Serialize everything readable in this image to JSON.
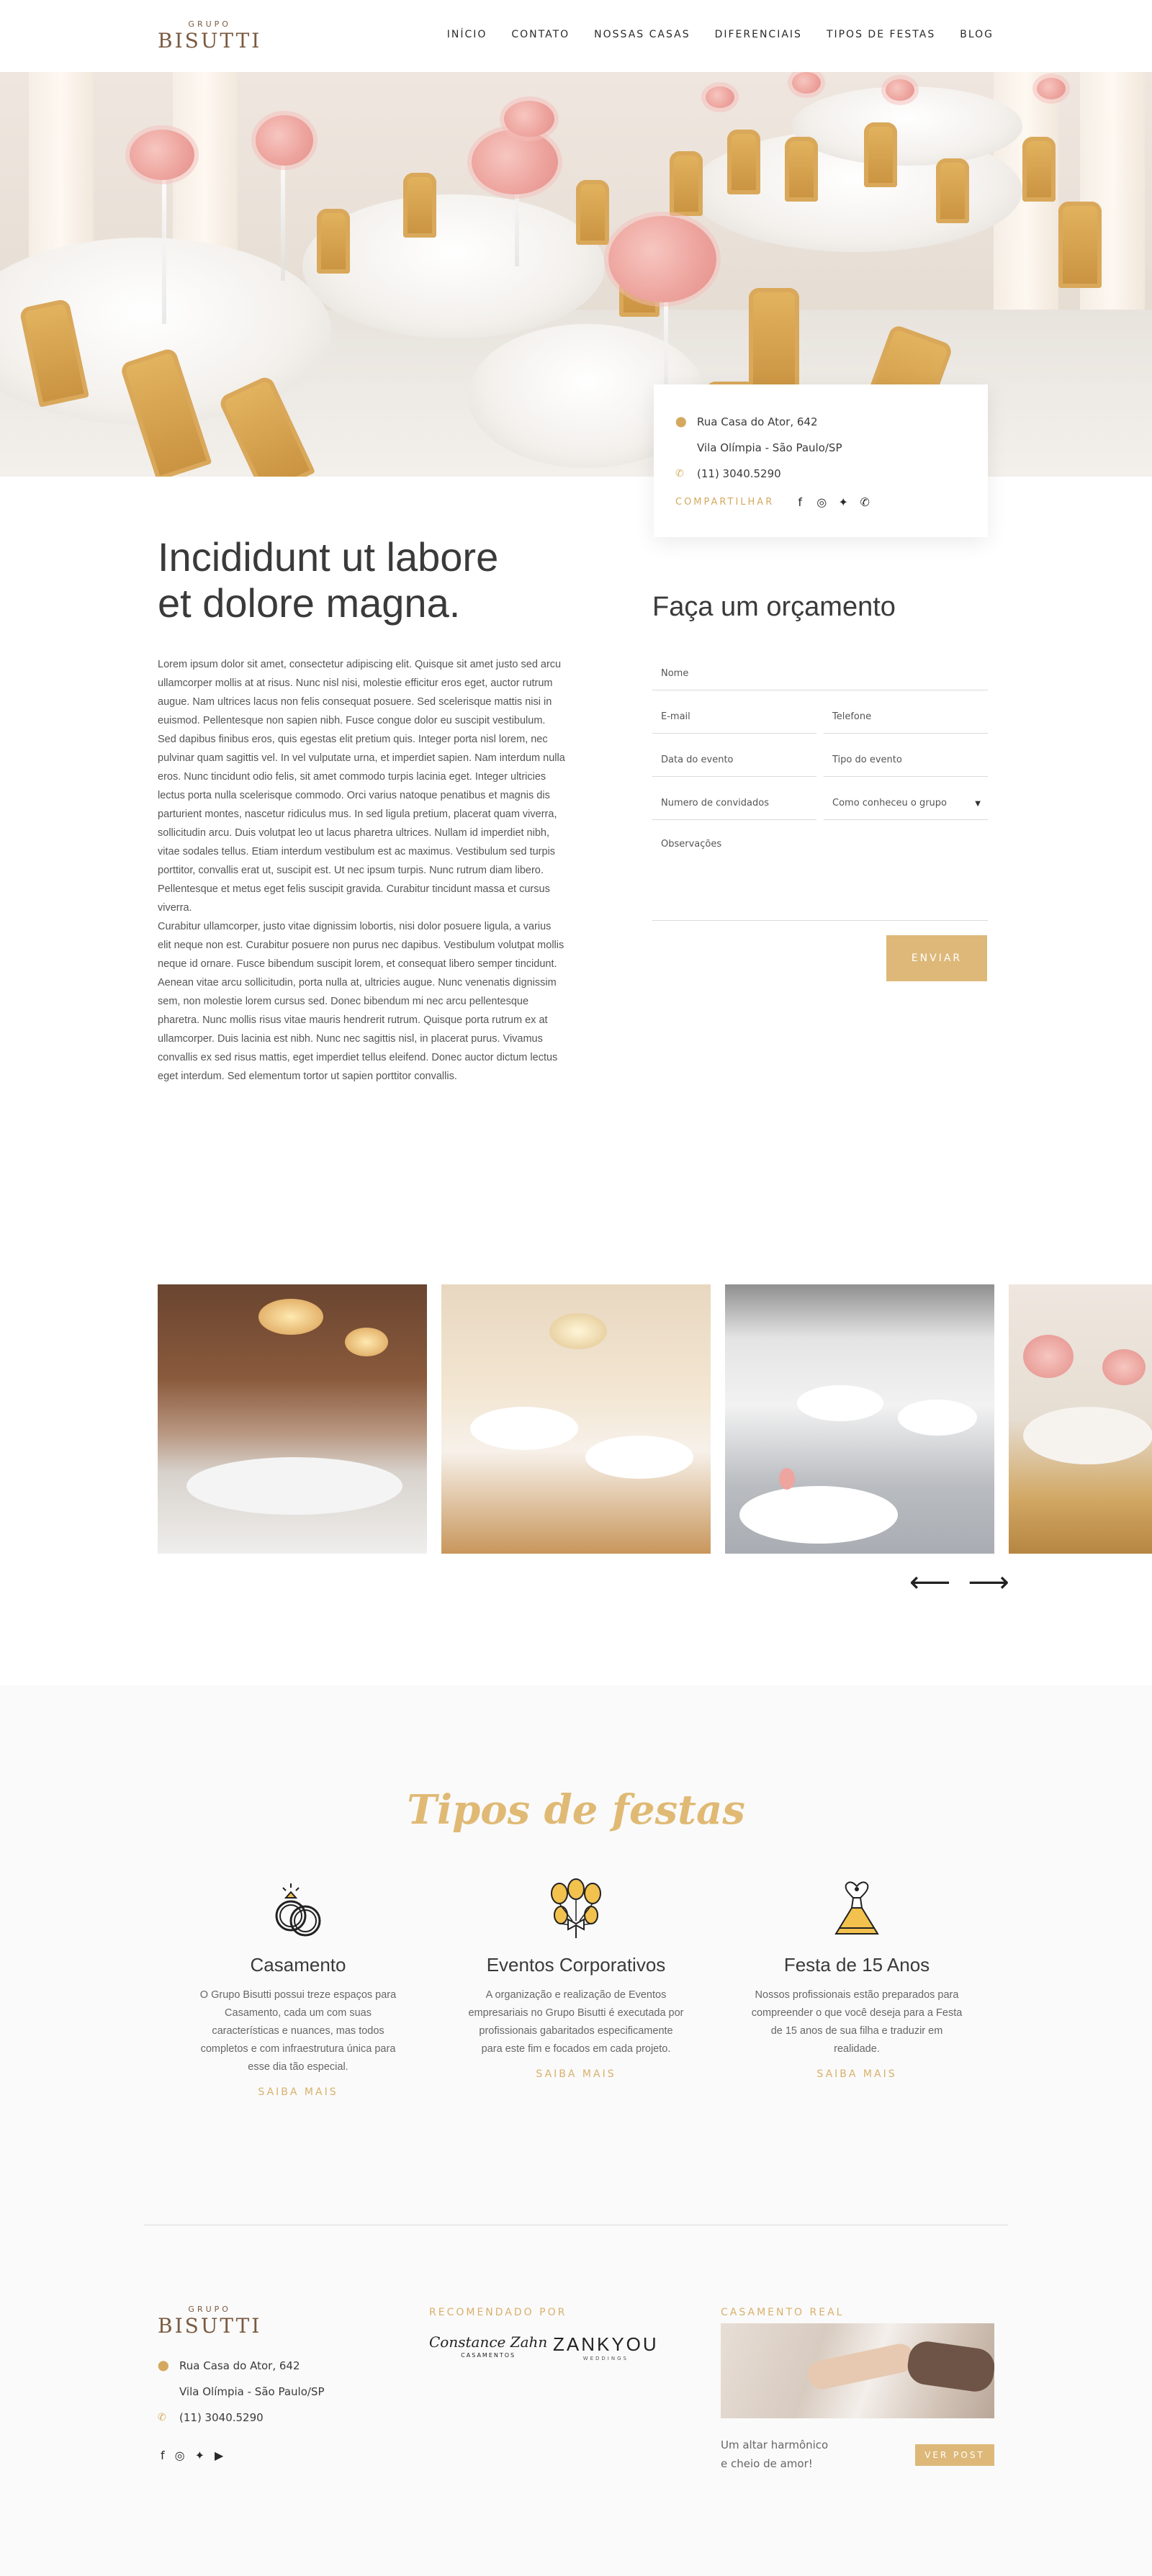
{
  "header": {
    "logo_small": "GRUPO",
    "logo_big": "BISUTTI",
    "nav": [
      "INÍCIO",
      "CONTATO",
      "NOSSAS CASAS",
      "DIFERENCIAIS",
      "TIPOS DE FESTAS",
      "BLOG"
    ]
  },
  "contact": {
    "address_line1": "Rua Casa do Ator, 642",
    "address_line2": "Vila Olímpia - São Paulo/SP",
    "phone": "(11) 3040.5290",
    "share_label": "COMPARTILHAR",
    "icons": [
      "map-pin-icon",
      "phone-icon",
      "facebook-icon",
      "instagram-icon",
      "twitter-icon",
      "whatsapp-icon"
    ]
  },
  "intro": {
    "title_line1": "Incididunt ut labore",
    "title_line2": "et dolore magna.",
    "paragraphs": [
      "Lorem ipsum dolor sit amet, consectetur adipiscing elit. Quisque sit amet justo sed arcu ullamcorper mollis at at risus. Nunc nisl nisi, molestie efficitur eros eget, auctor rutrum augue. Nam ultrices lacus non felis consequat posuere. Sed scelerisque mattis nisi in euismod. Pellentesque non sapien nibh. Fusce congue dolor eu suscipit vestibulum.",
      "Sed dapibus finibus eros, quis egestas elit pretium quis. Integer porta nisl lorem, nec pulvinar quam sagittis vel. In vel vulputate urna, et imperdiet sapien. Nam interdum nulla eros. Nunc tincidunt odio felis, sit amet commodo turpis lacinia eget. Integer ultricies lectus porta nulla scelerisque commodo. Orci varius natoque penatibus et magnis dis parturient montes, nascetur ridiculus mus. In sed ligula pretium, placerat quam viverra, sollicitudin arcu. Duis volutpat leo ut lacus pharetra ultrices. Nullam id imperdiet nibh, vitae sodales tellus. Etiam interdum vestibulum est ac maximus. Vestibulum sed turpis porttitor, convallis erat ut, suscipit est. Ut nec ipsum turpis. Nunc rutrum diam libero. Pellentesque et metus eget felis suscipit gravida. Curabitur tincidunt massa et cursus viverra.",
      "Curabitur ullamcorper, justo vitae dignissim lobortis, nisi dolor posuere ligula, a varius elit neque non est. Curabitur posuere non purus nec dapibus. Vestibulum volutpat mollis neque id ornare. Fusce bibendum suscipit lorem, et consequat libero semper tincidunt.",
      "Aenean vitae arcu sollicitudin, porta nulla at, ultricies augue. Nunc venenatis dignissim sem, non molestie lorem cursus sed. Donec bibendum mi nec arcu pellentesque pharetra. Nunc mollis risus vitae mauris hendrerit rutrum. Quisque porta rutrum ex at ullamcorper. Duis lacinia est nibh. Nunc nec sagittis nisl, in placerat purus. Vivamus convallis ex sed risus mattis, eget imperdiet tellus eleifend. Donec auctor dictum lectus eget interdum. Sed elementum tortor ut sapien porttitor convallis."
    ]
  },
  "form": {
    "title": "Faça um orçamento",
    "nome": "Nome",
    "email": "E-mail",
    "telefone": "Telefone",
    "data_evento": "Data do evento",
    "tipo_evento": "Tipo do evento",
    "convidados": "Numero de convidados",
    "como_conheceu": "Como conheceu o grupo",
    "observacoes": "Observações",
    "submit": "ENVIAR"
  },
  "gallery": {
    "prev_arrow": "⟵",
    "next_arrow": "⟶"
  },
  "festas": {
    "title": "Tipos de festas",
    "items": [
      {
        "title": "Casamento",
        "text": "O Grupo Bisutti possui treze espaços para Casamento, cada um com suas características e nuances, mas todos completos e com infraestrutura única para esse dia tão especial.",
        "link": "SAIBA MAIS",
        "icon": "wedding-rings-icon"
      },
      {
        "title": "Eventos Corporativos",
        "text": "A organização e realização de Eventos empresariais no Grupo Bisutti é executada por profissionais gabaritados especificamente para este fim e focados em cada projeto.",
        "link": "SAIBA MAIS",
        "icon": "balloons-icon"
      },
      {
        "title": "Festa de 15 Anos",
        "text": "Nossos profissionais estão preparados para compreender o que você deseja para a Festa de 15 anos de sua filha e traduzir em realidade.",
        "link": "SAIBA MAIS",
        "icon": "dress-icon"
      }
    ]
  },
  "footer": {
    "logo_small": "GRUPO",
    "logo_big": "BISUTTI",
    "address_line1": "Rua Casa do Ator, 642",
    "address_line2": "Vila Olímpia - São Paulo/SP",
    "phone": "(11) 3040.5290",
    "recommended_head": "RECOMENDADO POR",
    "partner1_name": "Constance Zahn",
    "partner1_sub": "CASAMENTOS",
    "partner2_name": "ZANKYOU",
    "partner2_sub": "WEDDINGS",
    "real_head": "CASAMENTO REAL",
    "real_text_line1": "Um altar harmônico",
    "real_text_line2": "e cheio de amor!",
    "post_button": "VER POST",
    "social_icons": [
      "facebook-icon",
      "instagram-icon",
      "twitter-icon",
      "youtube-icon"
    ]
  },
  "colors": {
    "accent_gold": "#ddb878",
    "brand_brown": "#7a5a40",
    "text_dark": "#3a3a3a"
  }
}
